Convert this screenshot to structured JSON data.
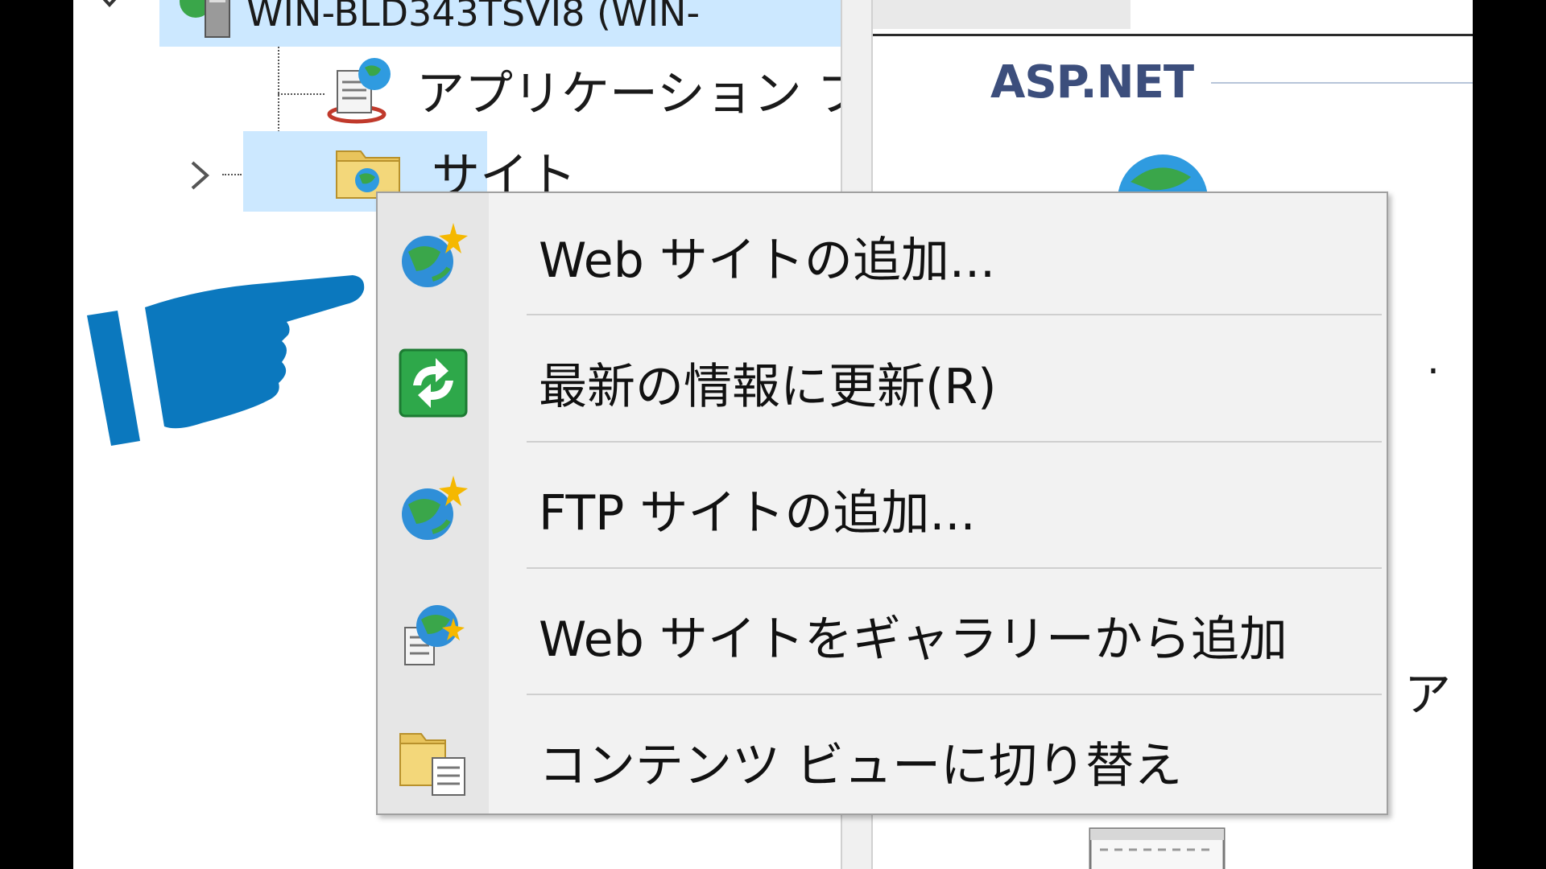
{
  "tree": {
    "server_label": "WIN-BLD343TSVI8 (WIN-",
    "app_pool_label": "アプリケーション プール",
    "sites_label": "サイト"
  },
  "right_pane": {
    "section_title": "ASP.NET",
    "fragment_dot": ".",
    "fragment_a": "ア"
  },
  "context_menu": {
    "items": [
      {
        "label": "Web サイトの追加...",
        "icon": "globe-add-icon"
      },
      {
        "label": "最新の情報に更新(R)",
        "icon": "refresh-icon"
      },
      {
        "label": "FTP サイトの追加...",
        "icon": "globe-add-icon"
      },
      {
        "label": "Web サイトをギャラリーから追加",
        "icon": "gallery-add-icon"
      },
      {
        "label": "コンテンツ ビューに切り替え",
        "icon": "content-view-icon"
      }
    ]
  },
  "colors": {
    "selection": "#cce8ff",
    "menu_bg": "#f2f2f2",
    "pointer": "#0b78be",
    "section_title": "#3c4e7c"
  }
}
